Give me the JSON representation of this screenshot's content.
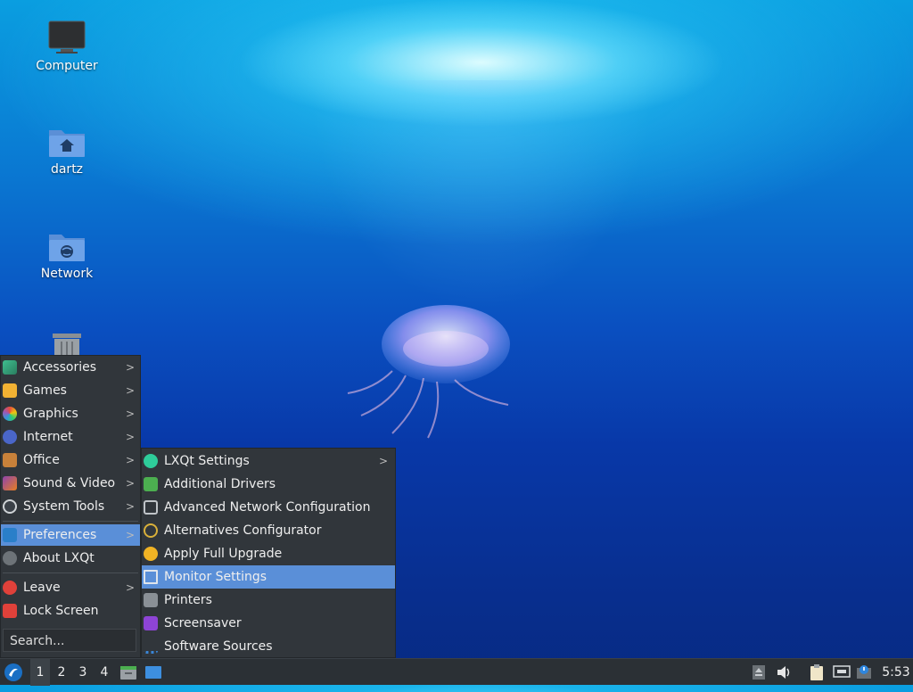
{
  "desktop": {
    "icons": [
      {
        "label": "Computer",
        "icon": "monitor-icon"
      },
      {
        "label": "dartz",
        "icon": "home-folder-icon"
      },
      {
        "label": "Network",
        "icon": "network-folder-icon"
      },
      {
        "label": "",
        "icon": "trash-icon"
      }
    ]
  },
  "menu": {
    "items": [
      {
        "label": "Accessories",
        "icon": "accessories-icon",
        "has_submenu": true
      },
      {
        "label": "Games",
        "icon": "games-icon",
        "has_submenu": true
      },
      {
        "label": "Graphics",
        "icon": "graphics-icon",
        "has_submenu": true
      },
      {
        "label": "Internet",
        "icon": "internet-icon",
        "has_submenu": true
      },
      {
        "label": "Office",
        "icon": "office-icon",
        "has_submenu": true
      },
      {
        "label": "Sound & Video",
        "icon": "sound-video-icon",
        "has_submenu": true
      },
      {
        "label": "System Tools",
        "icon": "system-tools-icon",
        "has_submenu": true
      },
      {
        "label": "Preferences",
        "icon": "preferences-icon",
        "has_submenu": true,
        "selected": true
      },
      {
        "label": "About LXQt",
        "icon": "info-icon",
        "has_submenu": false
      },
      {
        "label": "Leave",
        "icon": "power-icon",
        "has_submenu": true
      },
      {
        "label": "Lock Screen",
        "icon": "lock-icon",
        "has_submenu": false
      }
    ],
    "search_placeholder": "Search..."
  },
  "submenu": {
    "items": [
      {
        "label": "LXQt Settings",
        "icon": "lxqt-settings-icon",
        "has_submenu": true
      },
      {
        "label": "Additional Drivers",
        "icon": "chip-icon"
      },
      {
        "label": "Advanced Network Configuration",
        "icon": "network-config-icon"
      },
      {
        "label": "Alternatives Configurator",
        "icon": "alternatives-icon"
      },
      {
        "label": "Apply Full Upgrade",
        "icon": "upgrade-icon"
      },
      {
        "label": "Monitor Settings",
        "icon": "monitor-settings-icon",
        "selected": true
      },
      {
        "label": "Printers",
        "icon": "printer-icon"
      },
      {
        "label": "Screensaver",
        "icon": "screensaver-icon"
      },
      {
        "label": "Software Sources",
        "icon": "software-sources-icon"
      }
    ]
  },
  "taskbar": {
    "workspaces": [
      "1",
      "2",
      "3",
      "4"
    ],
    "active_workspace": "1",
    "clock": "5:53"
  },
  "colors": {
    "selection": "#5a8fd8",
    "menu_bg": "#31363b",
    "taskbar_bg": "#2b3035"
  }
}
